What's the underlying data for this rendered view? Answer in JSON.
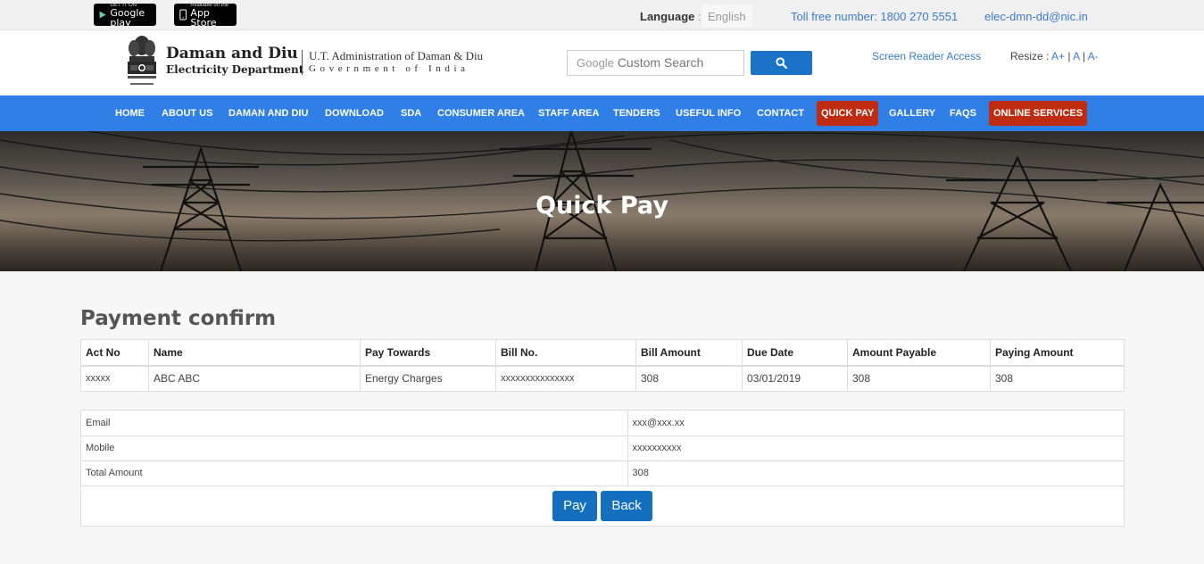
{
  "topbar": {
    "google_play": {
      "small": "GET IT ON",
      "big": "Google play"
    },
    "app_store": {
      "small": "Available on the",
      "big": "App Store"
    },
    "language_label": "Language",
    "language_sep": ":",
    "language_value": "English",
    "tollfree": "Toll free number: 1800 270 5551",
    "email": "elec-dmn-dd@nic.in"
  },
  "header": {
    "dept_line1": "Daman and Diu",
    "dept_line2": "Electricity Department",
    "admin_line1": "U.T. Administration of Daman & Diu",
    "admin_line2": "Government of India",
    "search_google": "Google",
    "search_placeholder": "Custom Search",
    "screen_reader": "Screen Reader Access",
    "resize_label": "Resize :",
    "resize_options": [
      "A+",
      "A",
      "A-"
    ]
  },
  "nav": {
    "items": [
      {
        "label": "HOME"
      },
      {
        "label": "ABOUT US"
      },
      {
        "label": "DAMAN AND DIU"
      },
      {
        "label": "DOWNLOAD"
      },
      {
        "label": "SDA"
      },
      {
        "label": "CONSUMER AREA"
      },
      {
        "label": "STAFF AREA"
      },
      {
        "label": "TENDERS"
      },
      {
        "label": "USEFUL INFO"
      },
      {
        "label": "CONTACT"
      },
      {
        "label": "QUICK PAY"
      },
      {
        "label": "GALLERY"
      },
      {
        "label": "FAQS"
      },
      {
        "label": "ONLINE SERVICES"
      }
    ],
    "highlight_color": "#c02c12",
    "bar_color": "#2f7fe6"
  },
  "banner": {
    "title": "Quick Pay"
  },
  "main": {
    "heading": "Payment confirm",
    "bill_table": {
      "headers": [
        "Act No",
        "Name",
        "Pay Towards",
        "Bill No.",
        "Bill Amount",
        "Due Date",
        "Amount Payable",
        "Paying Amount"
      ],
      "row": [
        "xxxxx",
        "ABC ABC",
        "Energy Charges",
        "xxxxxxxxxxxxxxx",
        "308",
        "03/01/2019",
        "308",
        "308"
      ]
    },
    "summary": {
      "email_label": "Email",
      "email_value": "xxx@xxx.xx",
      "mobile_label": "Mobile",
      "mobile_value": "xxxxxxxxxx",
      "total_label": "Total Amount",
      "total_value": "308"
    },
    "pay_label": "Pay",
    "back_label": "Back"
  }
}
